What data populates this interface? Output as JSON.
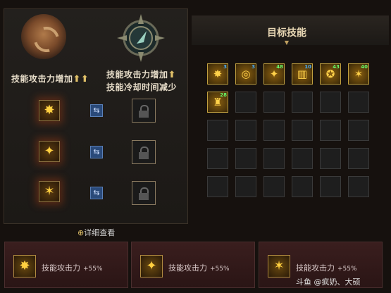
{
  "left": {
    "emblem_a_label": "技能攻击力增加",
    "emblem_b_label_line1": "技能攻击力增加",
    "emblem_b_label_line2": "技能冷却时间减少",
    "up_arrow": "⬆",
    "swap_glyph": "⇆",
    "detail_link": "详细查看"
  },
  "target": {
    "title": "目标技能",
    "skills": [
      {
        "icon": "fist-burst-icon",
        "glyph": "✸",
        "level": "3",
        "level_color": "#4ab0ff"
      },
      {
        "icon": "orb-icon",
        "glyph": "◎",
        "level": "3",
        "level_color": "#4ab0ff"
      },
      {
        "icon": "flying-kick-icon",
        "glyph": "✦",
        "level": "48",
        "level_color": "#6aff6a"
      },
      {
        "icon": "pillar-icon",
        "glyph": "▥",
        "level": "10",
        "level_color": "#4ab0ff"
      },
      {
        "icon": "warrior-icon",
        "glyph": "✪",
        "level": "43",
        "level_color": "#6aff6a"
      },
      {
        "icon": "slash-icon",
        "glyph": "✶",
        "level": "40",
        "level_color": "#6aff6a"
      },
      {
        "icon": "beast-icon",
        "glyph": "♜",
        "level": "28",
        "level_color": "#6aff6a"
      }
    ]
  },
  "cards": [
    {
      "glyph": "✸",
      "text": "技能攻击力",
      "pct": "+55%"
    },
    {
      "glyph": "✦",
      "text": "技能攻击力",
      "pct": "+55%"
    },
    {
      "glyph": "✶",
      "text": "技能攻击力",
      "pct": "+55%"
    }
  ],
  "watermark": "斗鱼 @疯奶、大硕"
}
